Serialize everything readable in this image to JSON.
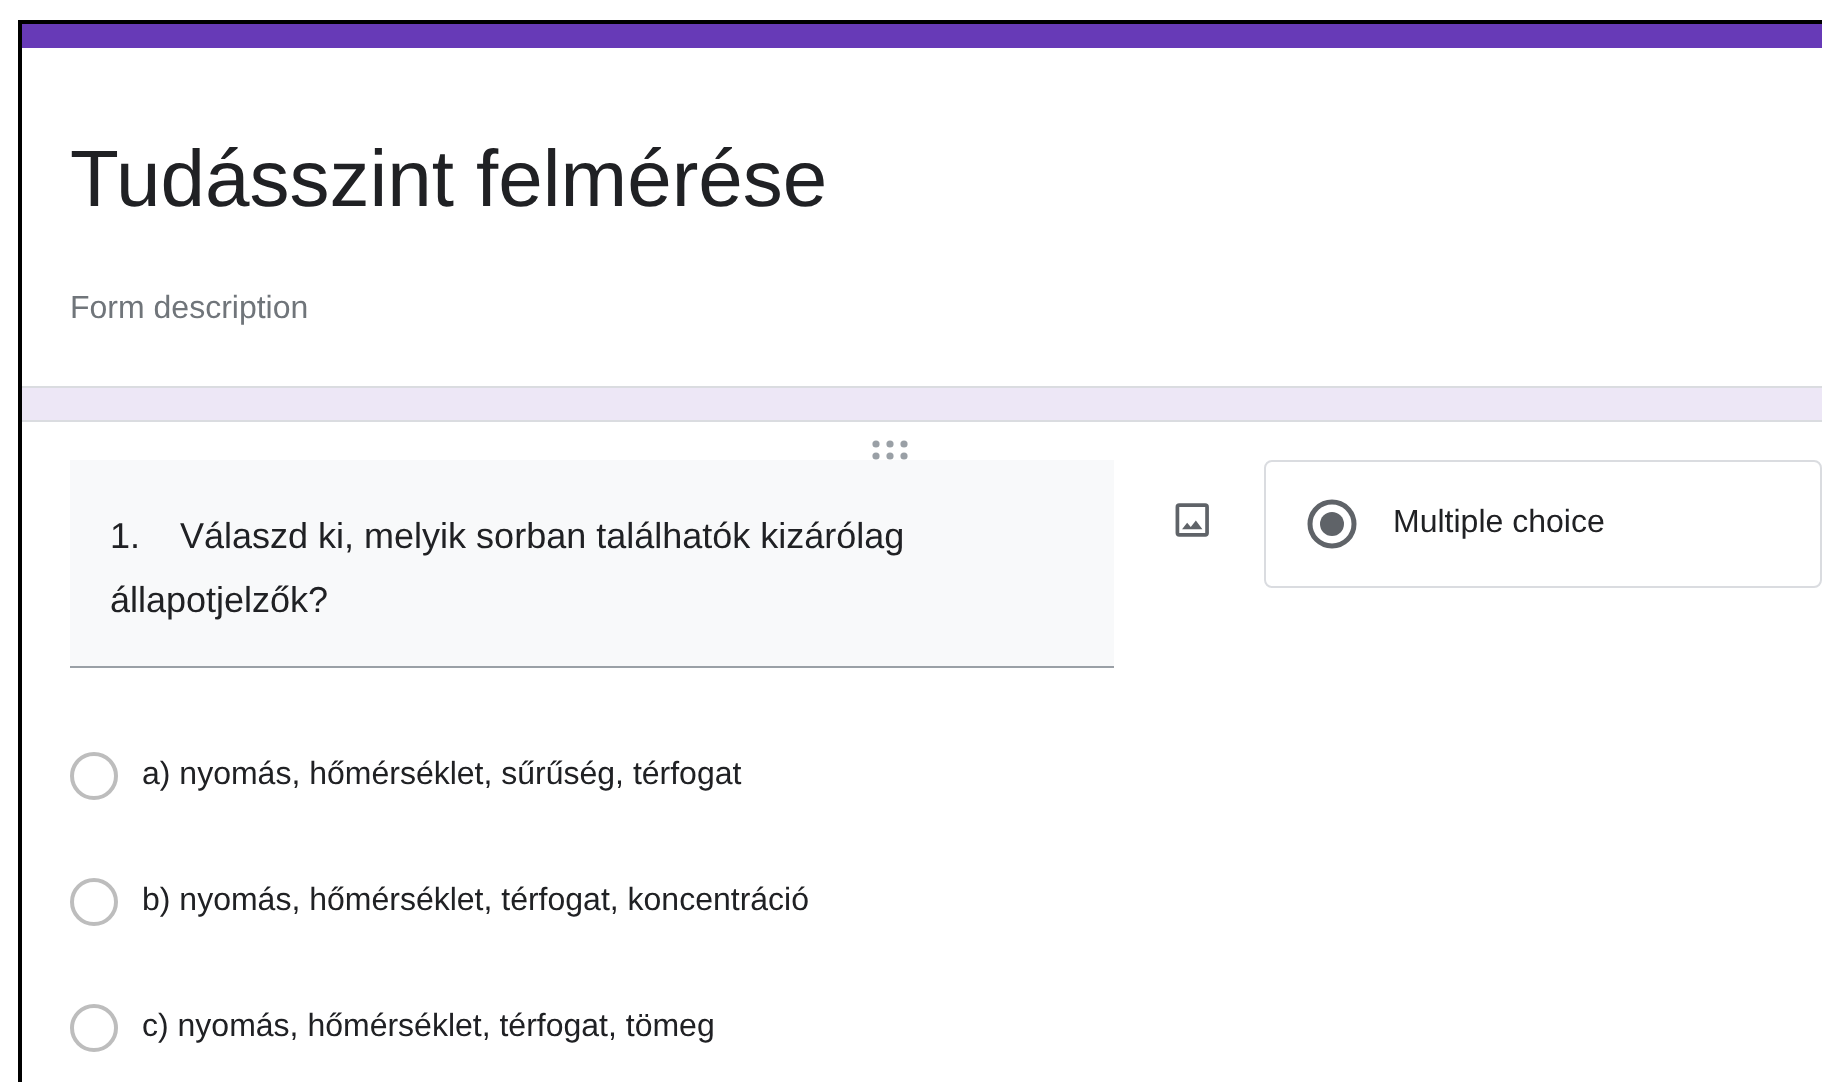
{
  "form": {
    "title": "Tudásszint felmérése",
    "description_placeholder": "Form description"
  },
  "question": {
    "number": "1.",
    "text": "Válaszd ki, melyik sorban találhatók kizárólag állapotjelzők?",
    "type": "Multiple choice",
    "options": [
      {
        "label": "a) nyomás, hőmérséklet, sűrűség, térfogat",
        "selected": false
      },
      {
        "label": "b) nyomás, hőmérséklet, térfogat, koncentráció",
        "selected": false
      },
      {
        "label": "c) nyomás, hőmérséklet, térfogat, tömeg",
        "selected": false
      }
    ]
  }
}
